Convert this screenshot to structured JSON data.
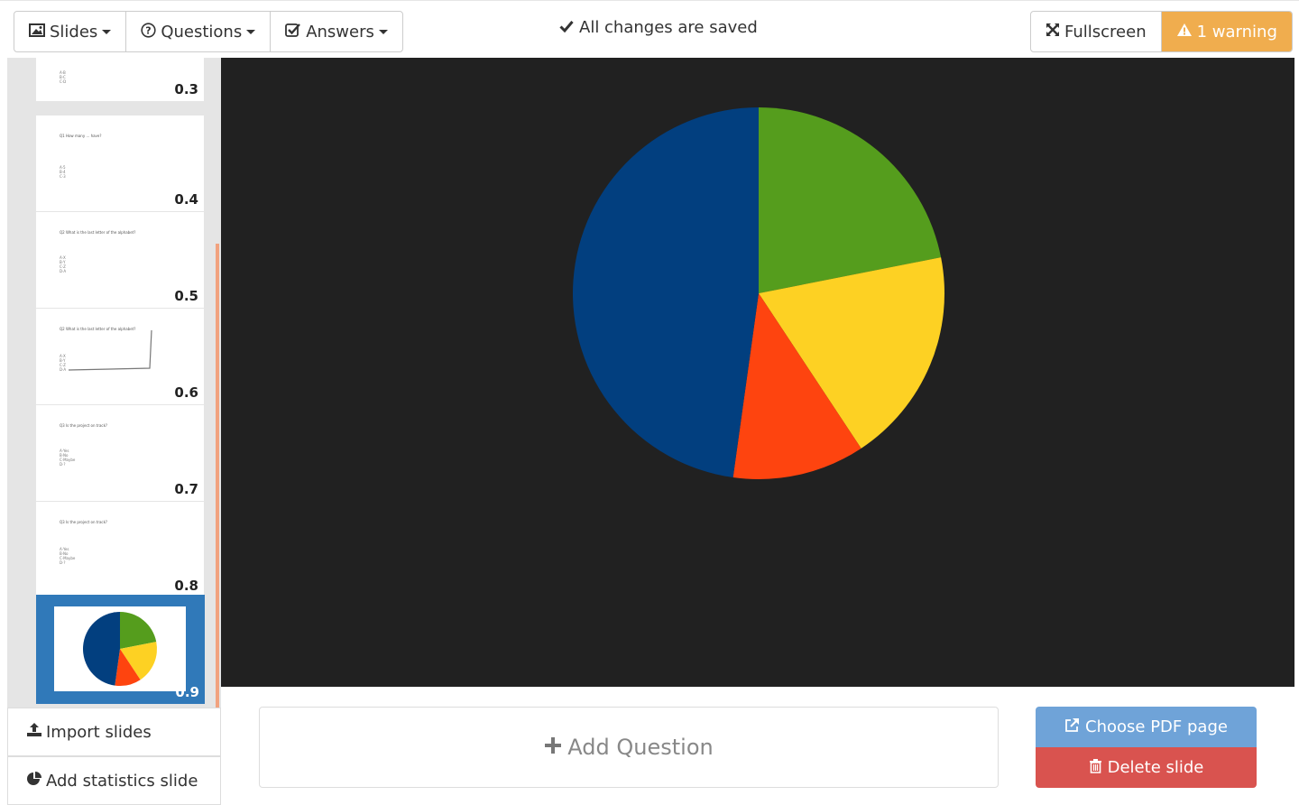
{
  "toolbar": {
    "slides_label": "Slides",
    "questions_label": "Questions",
    "answers_label": "Answers",
    "status": "All changes are saved",
    "fullscreen_label": "Fullscreen",
    "warning_label": "1 warning"
  },
  "icons": {
    "slides": "picture-icon",
    "questions": "question-circle-icon",
    "answers": "check-square-icon",
    "status": "check-icon",
    "fullscreen": "expand-icon",
    "warning": "warning-triangle-icon",
    "import": "upload-icon",
    "statistics": "pie-chart-icon",
    "add": "plus-icon",
    "pdf": "external-link-icon",
    "delete": "trash-icon"
  },
  "sidebar": {
    "slides": [
      {
        "number": "0.3",
        "question": ""
      },
      {
        "number": "0.4",
        "question": "Q1 How many ... have?"
      },
      {
        "number": "0.5",
        "question": "Q2 What is the last letter of the alphabet?"
      },
      {
        "number": "0.6",
        "question": "Q2 What is the last letter of the alphabet?"
      },
      {
        "number": "0.7",
        "question": "Q3 Is the project on track?"
      },
      {
        "number": "0.8",
        "question": "Q3 Is the project on track?"
      },
      {
        "number": "0.9",
        "question": ""
      }
    ],
    "selected_slide": "0.9",
    "import_label": "Import slides",
    "statistics_label": "Add statistics slide"
  },
  "chart_data": {
    "type": "pie",
    "categories": [
      "Green",
      "Yellow",
      "Red",
      "Blue"
    ],
    "values": [
      21.9,
      18.8,
      11.5,
      47.8
    ],
    "colors": [
      "#559d1d",
      "#fdd123",
      "#fe440f",
      "#023f7f"
    ]
  },
  "actions": {
    "add_question_label": "Add Question",
    "choose_pdf_label": "Choose PDF page",
    "delete_label": "Delete slide"
  },
  "colors": {
    "warning": "#f0ad4e",
    "selected_slide": "#3079b9",
    "stage_background": "#212121",
    "choose_pdf": "#6fa3d8",
    "delete": "#d9534f"
  }
}
